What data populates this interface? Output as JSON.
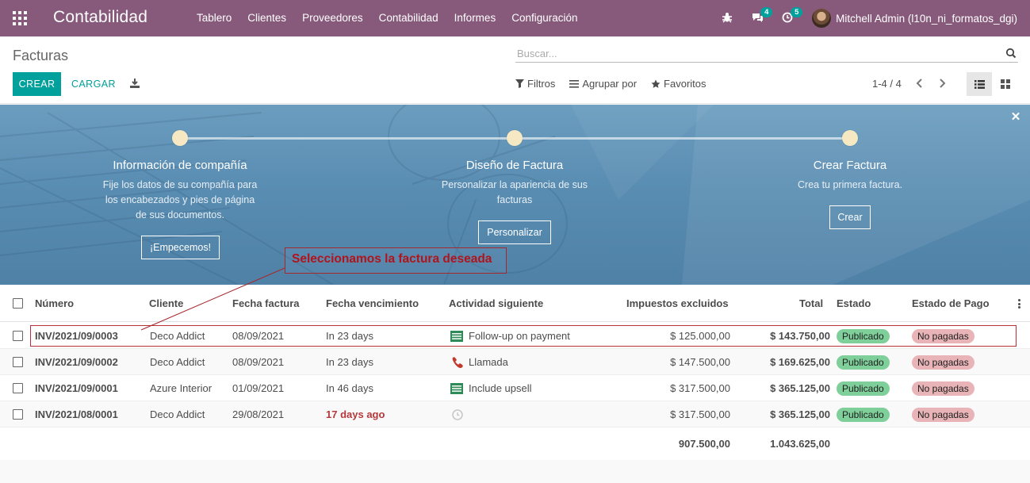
{
  "navbar": {
    "brand": "Contabilidad",
    "menu": [
      "Tablero",
      "Clientes",
      "Proveedores",
      "Contabilidad",
      "Informes",
      "Configuración"
    ],
    "messages_count": "4",
    "activities_count": "5",
    "user": "Mitchell Admin (l10n_ni_formatos_dgi)",
    "color": "#875a7b"
  },
  "control_panel": {
    "breadcrumb": "Facturas",
    "search_placeholder": "Buscar...",
    "create_label": "CREAR",
    "upload_label": "CARGAR",
    "filters_label": "Filtros",
    "groupby_label": "Agrupar por",
    "favorites_label": "Favoritos",
    "pager": "1-4 / 4",
    "accent": "#00a09d"
  },
  "onboarding": {
    "steps": [
      {
        "title": "Información de compañía",
        "text_lines": [
          "Fije los datos de su compañía para",
          "los encabezados y pies de página",
          "de sus documentos."
        ],
        "button": "¡Empecemos!"
      },
      {
        "title": "Diseño de Factura",
        "text_lines": [
          "Personalizar la apariencia de sus",
          "facturas"
        ],
        "button": "Personalizar"
      },
      {
        "title": "Crear Factura",
        "text_lines": [
          "Crea tu primera factura."
        ],
        "button": "Crear"
      }
    ]
  },
  "annotation": {
    "text": "Seleccionamos la factura deseada",
    "color": "#b0141d"
  },
  "table": {
    "columns": [
      "Número",
      "Cliente",
      "Fecha factura",
      "Fecha vencimiento",
      "Actividad siguiente",
      "Impuestos excluidos",
      "Total",
      "Estado",
      "Estado de Pago"
    ],
    "rows": [
      {
        "number": "INV/2021/09/0003",
        "customer": "Deco Addict",
        "date": "08/09/2021",
        "due": "In 23 days",
        "activity_icon": "invoice-icon",
        "activity": "Follow-up on payment",
        "untaxed": "$ 125.000,00",
        "total": "$ 143.750,00",
        "state": "Publicado",
        "payment": "No pagadas"
      },
      {
        "number": "INV/2021/09/0002",
        "customer": "Deco Addict",
        "date": "08/09/2021",
        "due": "In 23 days",
        "activity_icon": "phone-icon",
        "activity": "Llamada",
        "untaxed": "$ 147.500,00",
        "total": "$ 169.625,00",
        "state": "Publicado",
        "payment": "No pagadas"
      },
      {
        "number": "INV/2021/09/0001",
        "customer": "Azure Interior",
        "date": "01/09/2021",
        "due": "In 46 days",
        "activity_icon": "invoice-icon",
        "activity": "Include upsell",
        "untaxed": "$ 317.500,00",
        "total": "$ 365.125,00",
        "state": "Publicado",
        "payment": "No pagadas"
      },
      {
        "number": "INV/2021/08/0001",
        "customer": "Deco Addict",
        "date": "29/08/2021",
        "due": "17 days ago",
        "activity_icon": "clock-icon",
        "activity": "",
        "untaxed": "$ 317.500,00",
        "total": "$ 365.125,00",
        "state": "Publicado",
        "payment": "No pagadas"
      }
    ],
    "totals": {
      "untaxed": "907.500,00",
      "total": "1.043.625,00"
    },
    "colors": {
      "posted": "#7fcf9a",
      "unpaid": "#e8b4b7",
      "overdue": "#b5383b"
    }
  }
}
